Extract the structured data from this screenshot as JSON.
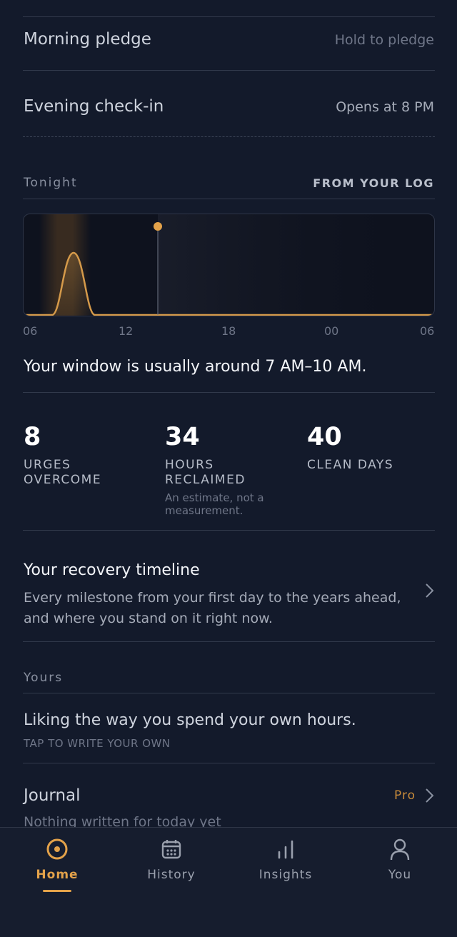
{
  "pledge": {
    "label": "Morning pledge",
    "action": "Hold to pledge"
  },
  "checkin": {
    "label": "Evening check-in",
    "status": "Opens at 8 PM"
  },
  "tonight": {
    "label": "Tonight",
    "source": "FROM YOUR LOG",
    "ticks": [
      "06",
      "12",
      "18",
      "00",
      "06"
    ]
  },
  "chart_data": {
    "type": "area",
    "x_domain": [
      "06",
      "06"
    ],
    "peak_window": "7 AM–10 AM",
    "current_marker": "2 PM",
    "accent": "#e3a24a"
  },
  "window_text": "Your window is usually around 7 AM–10 AM.",
  "stats": [
    {
      "value": "8",
      "label_line1": "URGES",
      "label_line2": "OVERCOME"
    },
    {
      "value": "34",
      "label_line1": "HOURS",
      "label_line2": "RECLAIMED",
      "note_line1": "An estimate, not a",
      "note_line2": "measurement."
    },
    {
      "value": "40",
      "label_line1": "CLEAN DAYS",
      "label_line2": ""
    }
  ],
  "timeline": {
    "title": "Your recovery timeline",
    "desc_line1": "Every milestone from your first day to the years ahead,",
    "desc_line2": "and where you stand on it right now."
  },
  "yours": {
    "label": "Yours",
    "text": "Liking the way you spend your own hours.",
    "hint": "TAP TO WRITE YOUR OWN"
  },
  "journal": {
    "title": "Journal",
    "badge": "Pro",
    "subtitle": "Nothing written for today yet"
  },
  "nav": {
    "home": "Home",
    "history": "History",
    "insights": "Insights",
    "you": "You"
  },
  "colors": {
    "accent": "#e3a24a",
    "background": "#131a2b"
  }
}
